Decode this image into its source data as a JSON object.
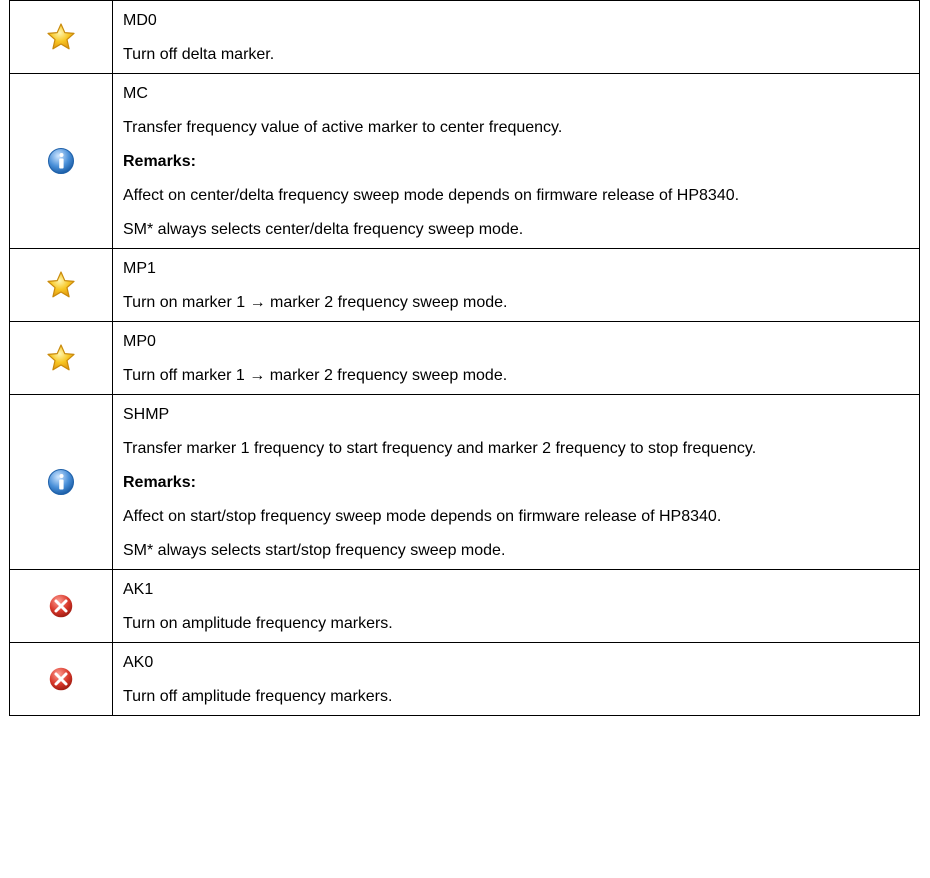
{
  "rows": [
    {
      "icon": "star-icon",
      "command": "MD0",
      "lines": [
        {
          "text": "Turn off delta marker.",
          "bold": false
        }
      ]
    },
    {
      "icon": "info-icon",
      "command": "MC",
      "lines": [
        {
          "text": "Transfer frequency value of active marker to center frequency.",
          "bold": false
        },
        {
          "text": "Remarks:",
          "bold": true
        },
        {
          "text": "Affect on center/delta frequency sweep mode depends on firmware release of HP8340.",
          "bold": false
        },
        {
          "text": "SM* always selects center/delta frequency sweep mode.",
          "bold": false
        }
      ]
    },
    {
      "icon": "star-icon",
      "command": "MP1",
      "lines": [
        {
          "text": "Turn on marker 1 → marker 2 frequency sweep mode.",
          "bold": false
        }
      ]
    },
    {
      "icon": "star-icon",
      "command": "MP0",
      "lines": [
        {
          "text": "Turn off marker 1 → marker 2 frequency sweep mode.",
          "bold": false
        }
      ]
    },
    {
      "icon": "info-icon",
      "command": "SHMP",
      "lines": [
        {
          "text": "Transfer marker 1 frequency to start frequency and marker 2 frequency to stop frequency.",
          "bold": false
        },
        {
          "text": "Remarks:",
          "bold": true
        },
        {
          "text": "Affect on start/stop frequency sweep mode depends on firmware release of HP8340.",
          "bold": false
        },
        {
          "text": "SM* always selects start/stop frequency sweep mode.",
          "bold": false
        }
      ]
    },
    {
      "icon": "error-icon",
      "command": "AK1",
      "lines": [
        {
          "text": "Turn on amplitude frequency markers.",
          "bold": false
        }
      ]
    },
    {
      "icon": "error-icon",
      "command": "AK0",
      "lines": [
        {
          "text": "Turn off amplitude frequency markers.",
          "bold": false
        }
      ]
    }
  ],
  "colors": {
    "star_fill": "#f7c623",
    "star_stroke": "#c98a0c",
    "info_fill": "#4a90d9",
    "error_fill": "#d8382b"
  }
}
